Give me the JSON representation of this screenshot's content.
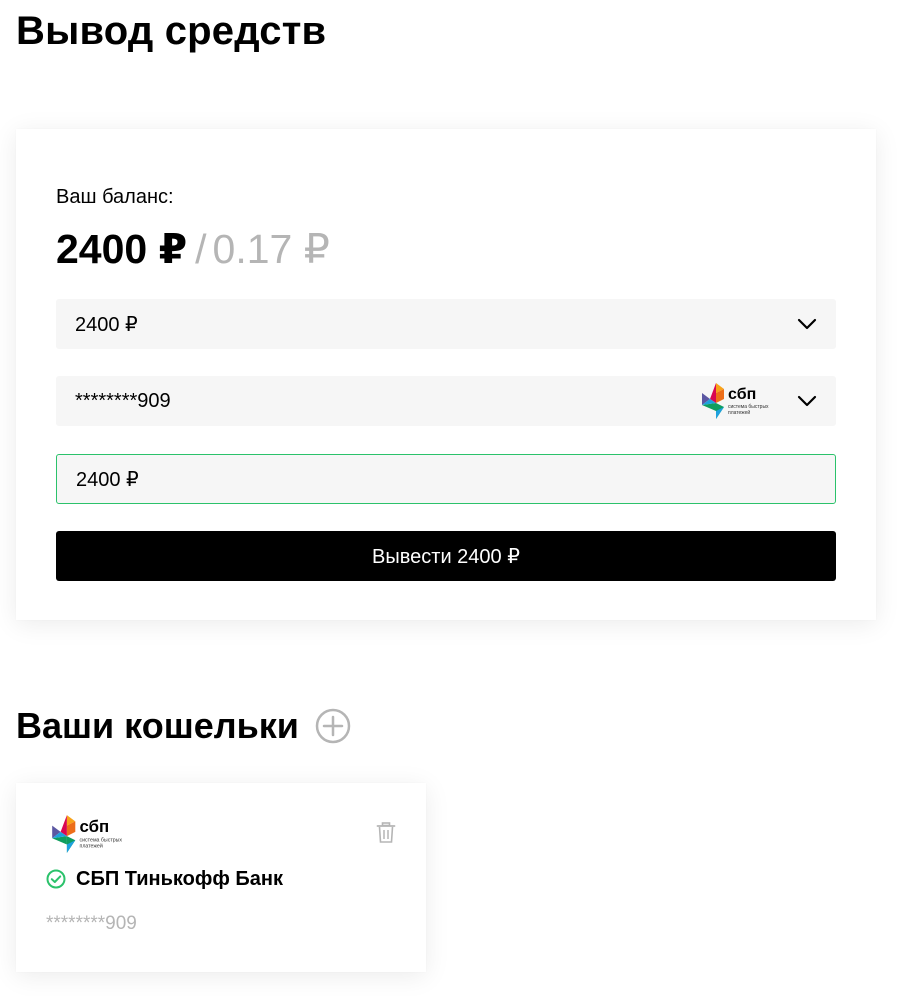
{
  "page": {
    "title": "Вывод средств"
  },
  "balance": {
    "label": "Ваш баланс:",
    "main": "2400 ₽",
    "separator": "/",
    "secondary": "0.17 ₽"
  },
  "withdraw_form": {
    "amount_select_value": "2400 ₽",
    "wallet_select_value": "********909",
    "wallet_logo": "sbp-logo",
    "amount_input_value": "2400 ₽",
    "submit_label": "Вывести 2400 ₽"
  },
  "wallets": {
    "title": "Ваши кошельки",
    "items": [
      {
        "logo": "sbp-logo",
        "name": "СБП Тинькофф Банк",
        "number": "********909",
        "verified": true
      }
    ]
  },
  "colors": {
    "accent_green": "#2bc26b",
    "button_bg": "#000000",
    "muted_text": "#b5b5b5",
    "field_bg": "#f6f6f6"
  },
  "logo_text": {
    "sbp_short": "сбп",
    "sbp_subtitle_line1": "система быстрых",
    "sbp_subtitle_line2": "платежей"
  }
}
